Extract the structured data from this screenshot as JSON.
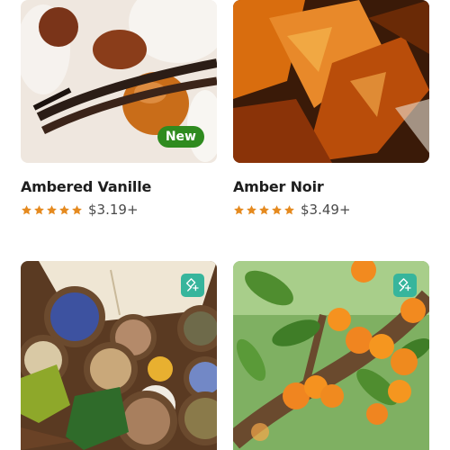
{
  "products": [
    {
      "name": "Ambered Vanille",
      "price": "$3.19+",
      "badge": "New",
      "rating": 5,
      "image": "vanilla-amber-photo",
      "icon": "star-icon"
    },
    {
      "name": "Amber Noir",
      "price": "$3.49+",
      "rating": 5,
      "image": "amber-resin-photo",
      "icon": "star-icon"
    },
    {
      "name": "",
      "price": "",
      "rating": 0,
      "image": "herbs-and-book-photo",
      "action_icon": "add-to-favorites-icon"
    },
    {
      "name": "",
      "price": "",
      "rating": 0,
      "image": "apricot-tree-photo",
      "action_icon": "add-to-favorites-icon"
    }
  ],
  "colors": {
    "accent": "#37b59c",
    "badge": "#2f8b1f",
    "star": "#e58a1f"
  }
}
